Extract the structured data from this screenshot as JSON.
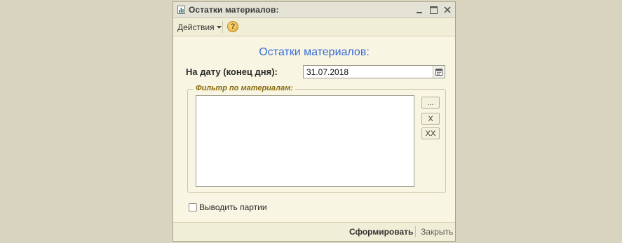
{
  "window": {
    "title": "Остатки материалов:",
    "toolbar": {
      "actions_label": "Действия",
      "help_glyph": "?"
    },
    "form_title": "Остатки материалов:",
    "date": {
      "label": "На дату (конец дня):",
      "value": "31.07.2018"
    },
    "filter": {
      "title": "Фильтр по материалам:",
      "buttons": {
        "select": "...",
        "remove": "X",
        "remove_all": "XX"
      }
    },
    "show_batches": {
      "label": "Выводить партии",
      "checked": false
    },
    "footer": {
      "generate": "Сформировать",
      "close": "Закрыть"
    }
  }
}
